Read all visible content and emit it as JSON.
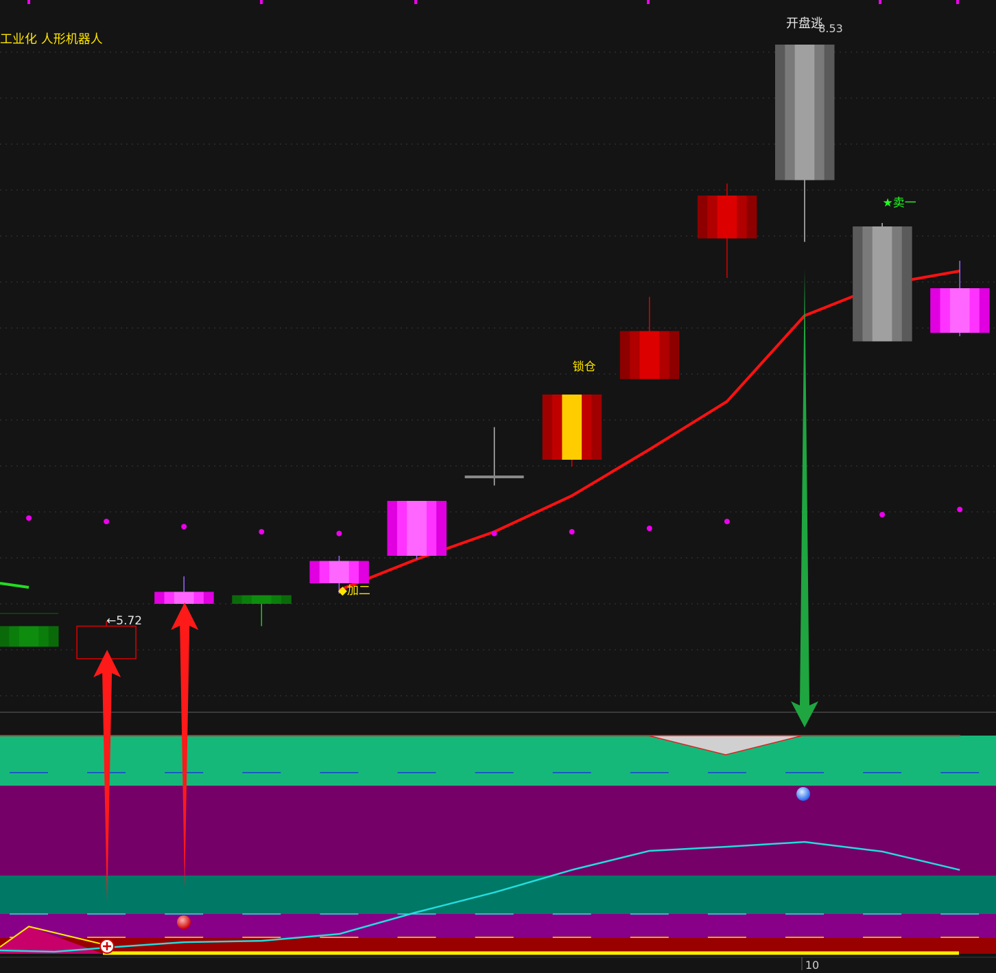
{
  "stock_label": "工业化 人形机器人",
  "colors": {
    "background": "#141414",
    "bull_red": "#dd0000",
    "bull_magenta": "#ff44ff",
    "bear_green": "#0b7a0b",
    "gray": "#8c8c8c",
    "lock_yellow": "#ffcc00",
    "ma_line": "#ff1111",
    "dot": "#ee00ee",
    "cyan": "#22dddd",
    "band_green": "#16b87a",
    "band_purple": "#750068",
    "band_teal": "#007866",
    "band_violet": "#880088",
    "band_darkred": "#990000",
    "pink_fill": "#c8006a",
    "yellow": "#ffee00"
  },
  "chart_data": [
    {
      "type": "candlestick",
      "title": "工业化 人形机器人",
      "index": [
        0,
        1,
        2,
        3,
        4,
        5,
        6,
        7,
        8,
        9,
        10,
        11,
        12
      ],
      "candles": [
        {
          "open": 5.835,
          "close": 5.775,
          "high": 5.82,
          "low": 5.775,
          "style": "green"
        },
        {
          "open": 5.74,
          "close": 5.835,
          "high": 5.85,
          "low": 5.72,
          "style": "hollow-red"
        },
        {
          "open": 5.9,
          "close": 5.935,
          "high": 5.98,
          "low": 5.86,
          "style": "magenta"
        },
        {
          "open": 5.9,
          "close": 5.925,
          "high": 5.925,
          "low": 5.835,
          "style": "green"
        },
        {
          "open": 5.96,
          "close": 6.025,
          "high": 6.04,
          "low": 5.93,
          "style": "magenta"
        },
        {
          "open": 6.04,
          "close": 6.2,
          "high": 6.2,
          "low": 6.03,
          "style": "magenta"
        },
        {
          "open": 6.27,
          "close": 6.27,
          "high": 6.415,
          "low": 6.245,
          "style": "gray-doji"
        },
        {
          "open": 6.32,
          "close": 6.51,
          "high": 6.51,
          "low": 6.3,
          "style": "lock"
        },
        {
          "open": 6.555,
          "close": 6.695,
          "high": 6.795,
          "low": 6.555,
          "style": "red"
        },
        {
          "open": 6.965,
          "close": 7.09,
          "high": 7.125,
          "low": 6.85,
          "style": "red"
        },
        {
          "open": 7.53,
          "close": 7.135,
          "high": 7.53,
          "low": 6.955,
          "style": "gray"
        },
        {
          "open": 7.0,
          "close": 6.665,
          "high": 7.01,
          "low": 6.665,
          "style": "gray"
        },
        {
          "open": 6.82,
          "close": 6.69,
          "high": 6.9,
          "low": 6.68,
          "style": "magenta"
        }
      ],
      "ma_line": {
        "start_index": 4,
        "values": [
          5.94,
          6.03,
          6.11,
          6.215,
          6.35,
          6.49,
          6.74,
          6.83,
          6.87
        ]
      },
      "dots": [
        6.15,
        6.14,
        6.125,
        6.11,
        6.105,
        null,
        6.105,
        6.11,
        6.12,
        6.14,
        6.15,
        6.16,
        6.175
      ],
      "annotations": [
        {
          "index": 10,
          "text": "开盘逃",
          "value_text": "8.53"
        },
        {
          "index": 11,
          "text": "★卖一"
        },
        {
          "index": 7,
          "text": "锁仓"
        },
        {
          "index": 4,
          "text": "◆加二"
        },
        {
          "index": 1,
          "text": "←5.72"
        }
      ],
      "arrows": [
        {
          "index": 1,
          "direction": "up",
          "color": "red"
        },
        {
          "index": 2,
          "direction": "up",
          "color": "red"
        },
        {
          "index": 10,
          "direction": "down",
          "color": "green"
        }
      ],
      "ylim": [
        5.6,
        7.6
      ]
    },
    {
      "type": "line",
      "panel": "indicator",
      "x_tick_labels": [
        "10"
      ],
      "x_tick_index": 10,
      "series": [
        {
          "key": "cyan",
          "values": [
            5,
            3,
            9,
            17,
            19,
            29,
            61,
            90,
            123,
            151,
            157,
            164,
            150,
            123,
            115
          ]
        },
        {
          "key": "yellow",
          "values": [
            10,
            40,
            14,
            0
          ]
        },
        {
          "key": "yellow-base",
          "values": [
            0,
            0
          ]
        }
      ],
      "x_positions": [
        0,
        0.33,
        1,
        2,
        3,
        4,
        5,
        6,
        7,
        8,
        9,
        10,
        11,
        12
      ],
      "ylim": [
        0,
        320
      ]
    }
  ]
}
